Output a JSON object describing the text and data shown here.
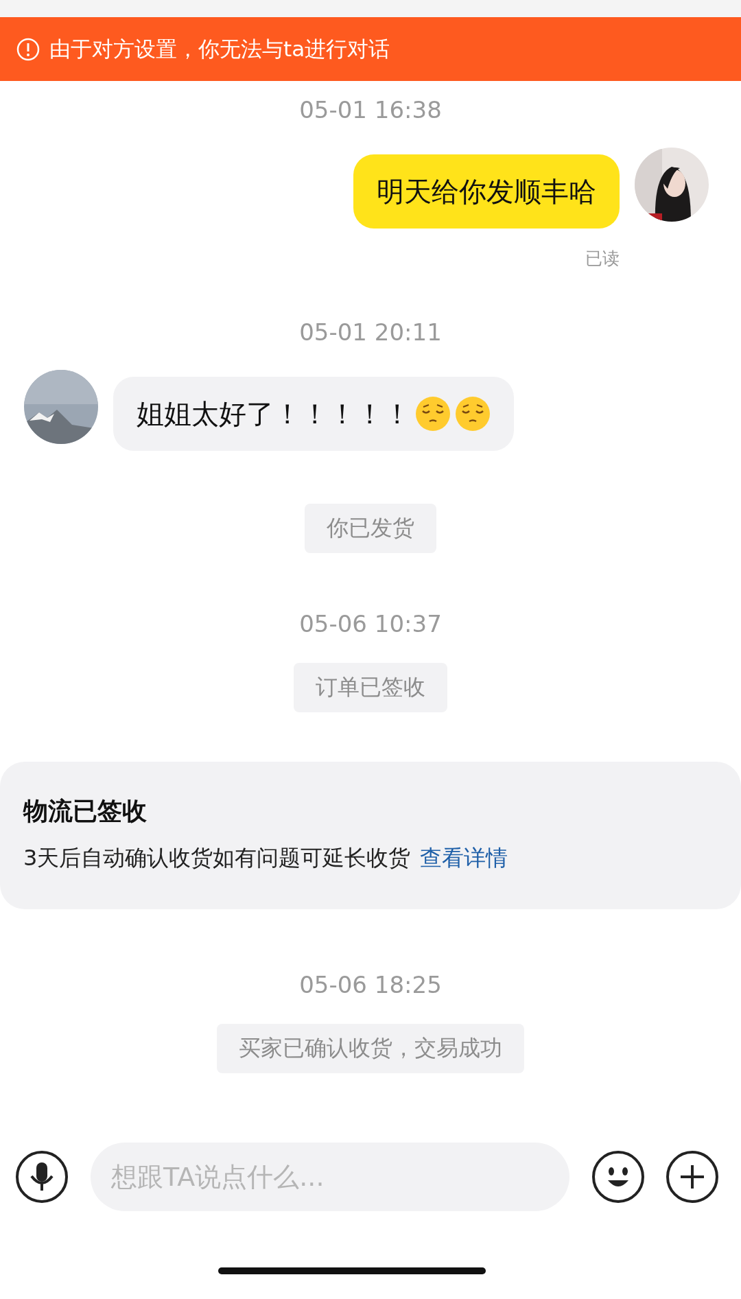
{
  "banner": {
    "text": "由于对方设置，你无法与ta进行对话"
  },
  "messages": [
    {
      "kind": "time",
      "text": "05-01 16:38"
    },
    {
      "kind": "sent",
      "text": "明天给你发顺丰哈",
      "receipt": "已读"
    },
    {
      "kind": "time",
      "text": "05-01 20:11"
    },
    {
      "kind": "received",
      "text": "姐姐太好了！！！！！"
    },
    {
      "kind": "notice",
      "text": "你已发货"
    },
    {
      "kind": "time",
      "text": "05-06 10:37"
    },
    {
      "kind": "notice",
      "text": "订单已签收"
    },
    {
      "kind": "card",
      "title": "物流已签收",
      "text": "3天后自动确认收货如有问题可延长收货",
      "link": "查看详情"
    },
    {
      "kind": "time",
      "text": "05-06 18:25"
    },
    {
      "kind": "notice",
      "text": "买家已确认收货，交易成功"
    }
  ],
  "composer": {
    "placeholder": "想跟TA说点什么..."
  }
}
